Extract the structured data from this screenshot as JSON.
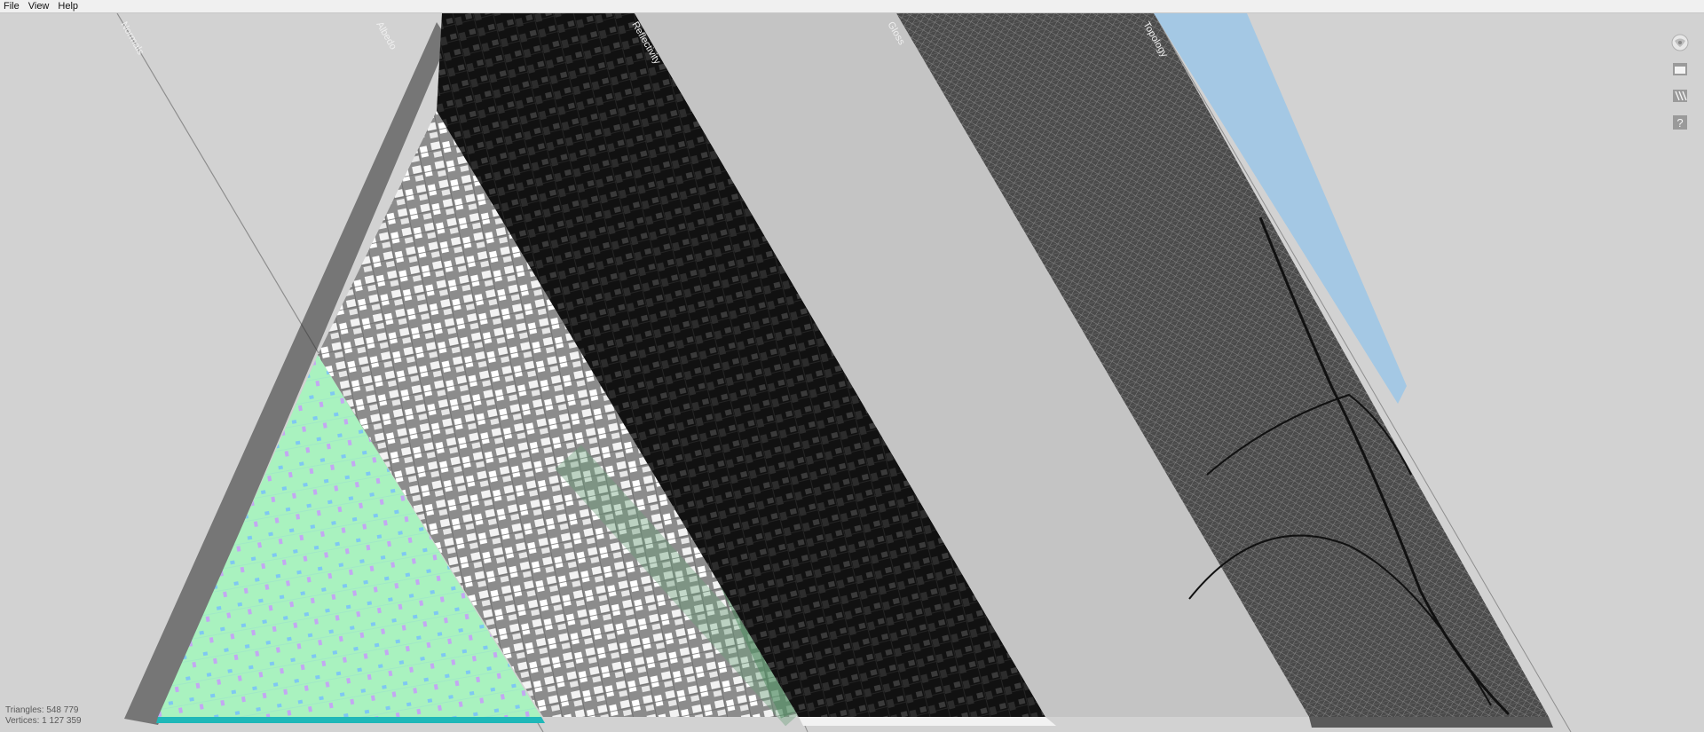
{
  "menubar": {
    "items": [
      {
        "label": "File"
      },
      {
        "label": "View"
      },
      {
        "label": "Help"
      }
    ]
  },
  "viewport": {
    "pass_labels": [
      "Normals",
      "Albedo",
      "Reflectivity",
      "Gloss",
      "Topology"
    ],
    "colors": {
      "background": "#d2d2d2",
      "normals": "#a9f2bf",
      "albedo_ground": "#8f8f8f",
      "reflectivity": "#0e0e0e",
      "gloss": "#c4c4c4",
      "topology": "#3a3a3a",
      "water": "#a4c8e4"
    }
  },
  "toolbar": {
    "buttons": [
      {
        "name": "globe-icon"
      },
      {
        "name": "window-icon"
      },
      {
        "name": "layers-icon"
      },
      {
        "name": "help-icon",
        "label": "?"
      }
    ]
  },
  "stats": {
    "triangles": "Triangles: 548 779",
    "vertices": "Vertices: 1 127 359"
  }
}
